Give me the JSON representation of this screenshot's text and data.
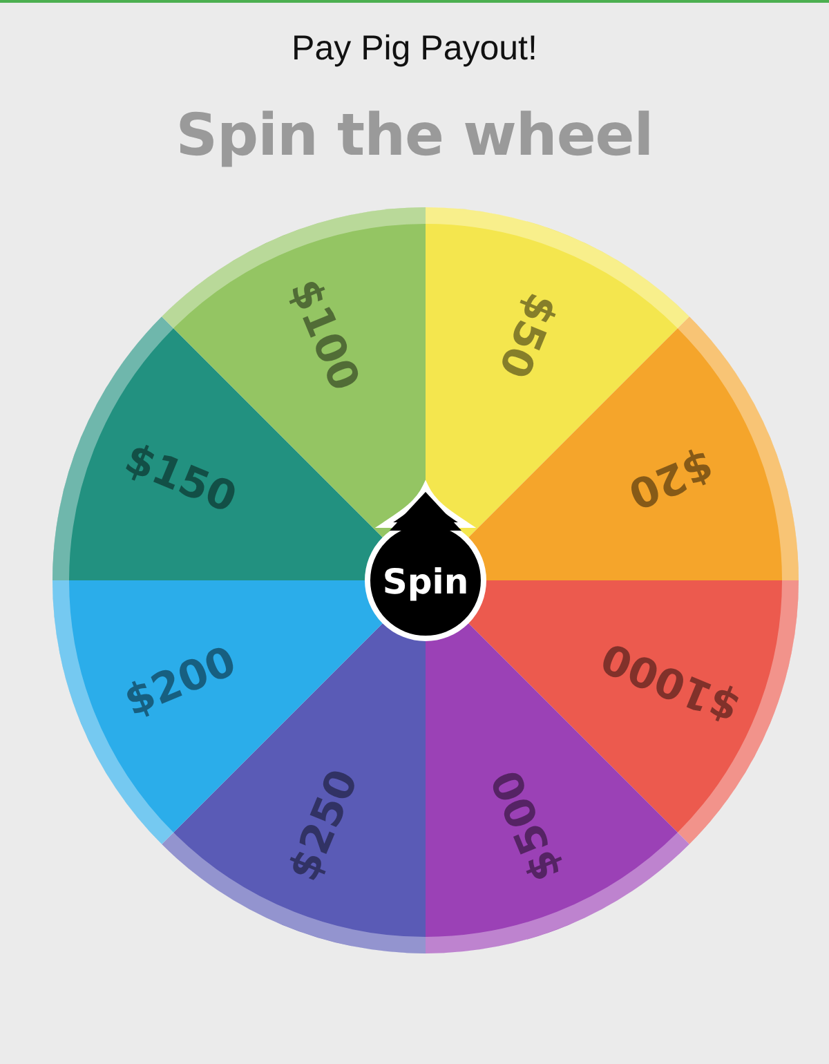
{
  "title": "Pay Pig Payout!",
  "heading": "Spin the wheel",
  "wheel": {
    "segments": [
      {
        "label": "$50",
        "color": "#f4e64e"
      },
      {
        "label": "$20",
        "color": "#f5a52b"
      },
      {
        "label": "$1000",
        "color": "#ec5a4e"
      },
      {
        "label": "$500",
        "color": "#9b41b6"
      },
      {
        "label": "$250",
        "color": "#5a5bb6"
      },
      {
        "label": "$200",
        "color": "#2badea"
      },
      {
        "label": "$150",
        "color": "#229180"
      },
      {
        "label": "$100",
        "color": "#94c563"
      }
    ],
    "spin_button": "Spin"
  }
}
